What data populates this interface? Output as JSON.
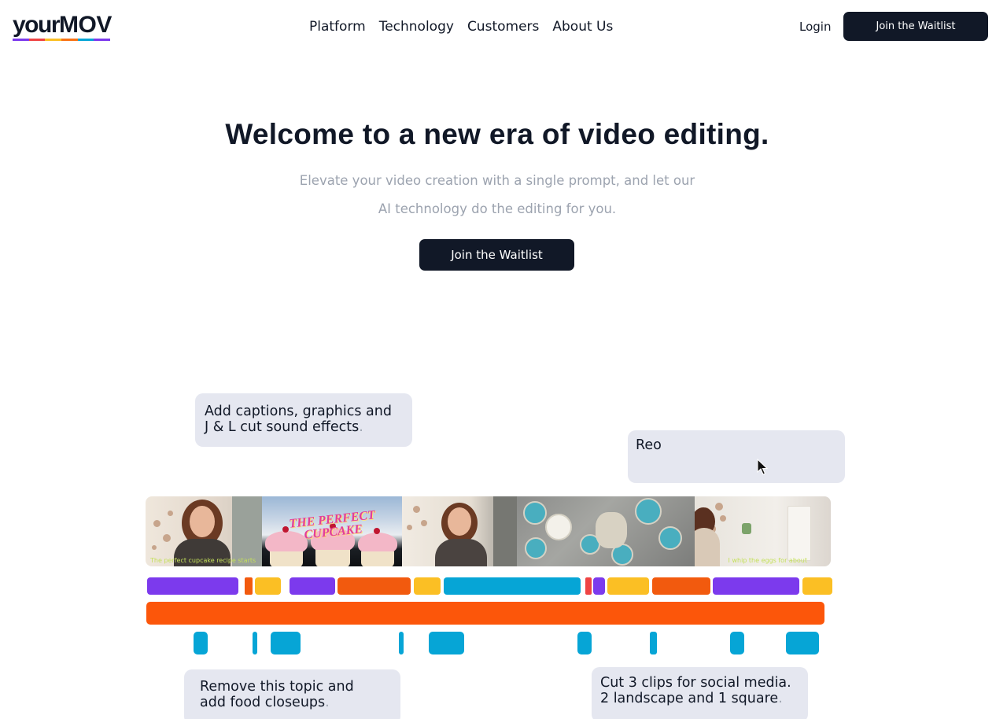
{
  "brand": {
    "logo_your": "your",
    "logo_mov": "MOV",
    "stripe_colors": [
      "#7c3aed",
      "#ef4444",
      "#fbbf24",
      "#f97316",
      "#06a5d6",
      "#7c3aed"
    ]
  },
  "nav": {
    "items": [
      {
        "label": "Platform"
      },
      {
        "label": "Technology"
      },
      {
        "label": "Customers"
      },
      {
        "label": "About Us"
      }
    ],
    "login_label": "Login",
    "cta_label": "Join the Waitlist"
  },
  "hero": {
    "title": "Welcome to a new era of video editing.",
    "subtitle_line1": "Elevate your video creation with a single prompt, and let our",
    "subtitle_line2": "AI technology do the editing for you.",
    "cta_label": "Join the Waitlist"
  },
  "prompts": {
    "p1_line1": "Add captions, graphics and",
    "p1_line2": "J & L cut sound effects",
    "p2_typing": "Reo",
    "p3_line1": "Remove this topic and",
    "p3_line2": "add food closeups",
    "p4_line1": "Cut 3 clips for social media.",
    "p4_line2": "2 landscape and 1 square",
    "period": "."
  },
  "filmstrip": {
    "caption1": "The perfect cupcake recipe starts",
    "title_card": "THE PERFECT CUPCAKE",
    "caption2": "I whip the eggs for about"
  },
  "colors": {
    "dark": "#111827",
    "bubble": "#e5e7f0",
    "purple": "#7c3aed",
    "orange": "#f25a0e",
    "yellow": "#fbbf24",
    "blue": "#06a5d6",
    "red": "#ef4444"
  }
}
